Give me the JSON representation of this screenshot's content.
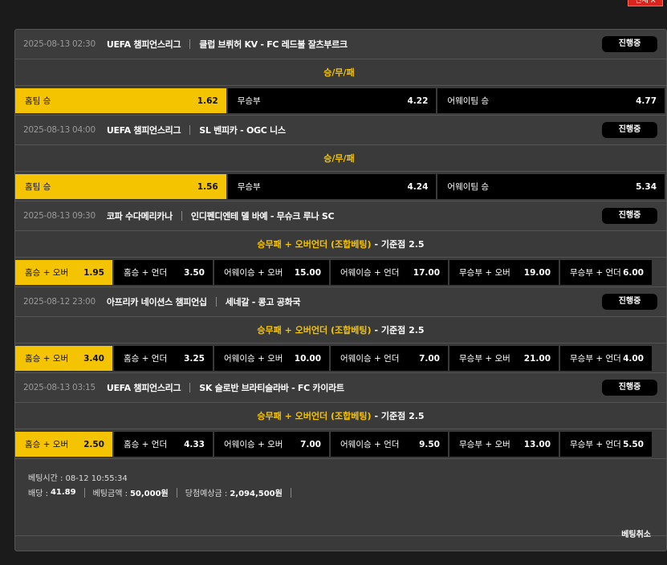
{
  "top_button": "전체 X",
  "status_label": "진행중",
  "matches": [
    {
      "date": "2025-08-13 02:30",
      "league": "UEFA 챔피언스리그",
      "teams": "클럽 브뤼허 KV - FC 레드불 잘츠부르크",
      "market": "승/무/패",
      "base": "",
      "options": [
        {
          "label": "홈팀 승",
          "odds": "1.62",
          "selected": true
        },
        {
          "label": "무승부",
          "odds": "4.22",
          "selected": false
        },
        {
          "label": "어웨이팀 승",
          "odds": "4.77",
          "selected": false
        }
      ]
    },
    {
      "date": "2025-08-13 04:00",
      "league": "UEFA 챔피언스리그",
      "teams": "SL 벤피카 - OGC 니스",
      "market": "승/무/패",
      "base": "",
      "options": [
        {
          "label": "홈팀 승",
          "odds": "1.56",
          "selected": true
        },
        {
          "label": "무승부",
          "odds": "4.24",
          "selected": false
        },
        {
          "label": "어웨이팀 승",
          "odds": "5.34",
          "selected": false
        }
      ]
    },
    {
      "date": "2025-08-13 09:30",
      "league": "코파 수다메리카나",
      "teams": "인디펜디엔테 델 바예 - 무슈크 루나 SC",
      "market": "승무패 + 오버언더 (조합베팅)",
      "base": " - 기준점 2.5",
      "options": [
        {
          "label": "홈승 + 오버",
          "odds": "1.95",
          "selected": true
        },
        {
          "label": "홈승 + 언더",
          "odds": "3.50",
          "selected": false
        },
        {
          "label": "어웨이승 + 오버",
          "odds": "15.00",
          "selected": false
        },
        {
          "label": "어웨이승 + 언더",
          "odds": "17.00",
          "selected": false
        },
        {
          "label": "무승부 + 오버",
          "odds": "19.00",
          "selected": false
        },
        {
          "label": "무승부 + 언더",
          "odds": "6.00",
          "selected": false
        }
      ]
    },
    {
      "date": "2025-08-12 23:00",
      "league": "아프리카 네이션스 챔피언십",
      "teams": "세네갈 - 콩고 공화국",
      "market": "승무패 + 오버언더 (조합베팅)",
      "base": " - 기준점 2.5",
      "options": [
        {
          "label": "홈승 + 오버",
          "odds": "3.40",
          "selected": true
        },
        {
          "label": "홈승 + 언더",
          "odds": "3.25",
          "selected": false
        },
        {
          "label": "어웨이승 + 오버",
          "odds": "10.00",
          "selected": false
        },
        {
          "label": "어웨이승 + 언더",
          "odds": "7.00",
          "selected": false
        },
        {
          "label": "무승부 + 오버",
          "odds": "21.00",
          "selected": false
        },
        {
          "label": "무승부 + 언더",
          "odds": "4.00",
          "selected": false
        }
      ]
    },
    {
      "date": "2025-08-13 03:15",
      "league": "UEFA 챔피언스리그",
      "teams": "SK 슬로반 브라티슬라바 - FC 카이라트",
      "market": "승무패 + 오버언더 (조합베팅)",
      "base": " - 기준점 2.5",
      "options": [
        {
          "label": "홈승 + 오버",
          "odds": "2.50",
          "selected": true
        },
        {
          "label": "홈승 + 언더",
          "odds": "4.33",
          "selected": false
        },
        {
          "label": "어웨이승 + 오버",
          "odds": "7.00",
          "selected": false
        },
        {
          "label": "어웨이승 + 언더",
          "odds": "9.50",
          "selected": false
        },
        {
          "label": "무승부 + 오버",
          "odds": "13.00",
          "selected": false
        },
        {
          "label": "무승부 + 언더",
          "odds": "5.50",
          "selected": false
        }
      ]
    }
  ],
  "summary": {
    "bet_time_label": "베팅시간 :",
    "bet_time": "08-12 10:55:34",
    "odds_label": "배당 :",
    "odds": "41.89",
    "amount_label": "베팅금액 :",
    "amount": "50,000원",
    "expected_label": "당첨예상금 :",
    "expected": "2,094,500원"
  },
  "cancel_label": "베팅취소"
}
